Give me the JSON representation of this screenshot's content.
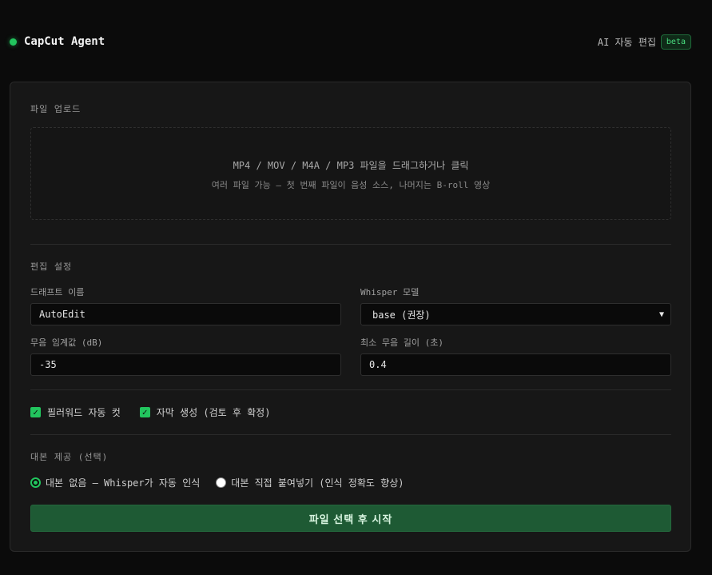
{
  "header": {
    "title": "CapCut Agent",
    "subtitle": "AI 자동 편집",
    "badge": "beta"
  },
  "upload": {
    "section_label": "파일 업로드",
    "primary_text": "MP4 / MOV / M4A / MP3 파일을 드래그하거나 클릭",
    "secondary_text": "여러 파일 가능 — 첫 번째 파일이 음성 소스, 나머지는 B-roll 영상"
  },
  "settings": {
    "section_label": "편집 설정",
    "draft_name_label": "드래프트 이름",
    "draft_name_value": "AutoEdit",
    "whisper_label": "Whisper 모델",
    "whisper_value": "base (권장)",
    "silence_label": "무음 임계값 (dB)",
    "silence_value": "-35",
    "min_silence_label": "최소 무음 길이 (초)",
    "min_silence_value": "0.4"
  },
  "options": {
    "filler_cut": "필러워드 자동 컷",
    "subtitles": "자막 생성 (검토 후 확정)"
  },
  "script": {
    "section_label": "대본 제공 (선택)",
    "option_auto": "대본 없음 — Whisper가 자동 인식",
    "option_paste": "대본 직접 붙여넣기 (인식 정확도 향상)"
  },
  "action": {
    "start_label": "파일 선택 후 시작"
  },
  "colors": {
    "accent": "#22c55e",
    "button_bg": "#1e5a34",
    "background": "#0b0b0b",
    "card": "#171717"
  }
}
